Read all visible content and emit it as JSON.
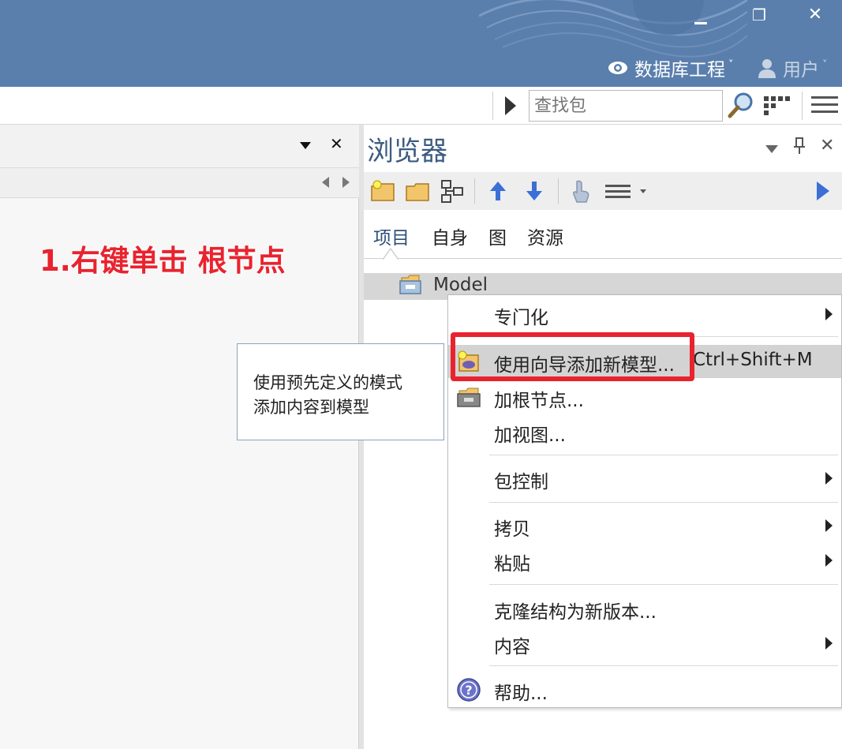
{
  "window": {
    "minimize_glyph": "▁",
    "restore_glyph": "❐",
    "close_glyph": "✕"
  },
  "header": {
    "project_label": "数据库工程",
    "user_label": "用户",
    "caret": "˅"
  },
  "toolbar": {
    "search_placeholder": "查找包"
  },
  "left_pane": {
    "close_glyph": "✕",
    "annotation": "1.右键单击 根节点"
  },
  "browser": {
    "title": "浏览器",
    "close_glyph": "✕",
    "tabs": [
      {
        "label": "项目",
        "active": true
      },
      {
        "label": "自身",
        "active": false
      },
      {
        "label": "图",
        "active": false
      },
      {
        "label": "资源",
        "active": false
      }
    ],
    "tree": {
      "root_label": "Model"
    }
  },
  "context_menu": {
    "items": [
      {
        "label": "专门化",
        "submenu": true
      },
      {
        "label": "使用向导添加新模型...",
        "shortcut": "Ctrl+Shift+M",
        "highlighted": true,
        "icon": "wizard-model-icon"
      },
      {
        "label": "加根节点...",
        "icon": "root-node-icon"
      },
      {
        "label": "加视图..."
      },
      {
        "label": "包控制",
        "submenu": true
      },
      {
        "label": "拷贝",
        "submenu": true
      },
      {
        "label": "粘贴",
        "submenu": true
      },
      {
        "label": "克隆结构为新版本..."
      },
      {
        "label": "内容",
        "submenu": true
      },
      {
        "label": "帮助...",
        "icon": "help-icon"
      }
    ]
  },
  "tooltip": {
    "line1": "使用预先定义的模式",
    "line2": "添加内容到模型"
  },
  "colors": {
    "titlebar": "#5a7fad",
    "annotation_red": "#e8232f",
    "browser_title": "#3c5c82",
    "arrow_blue": "#3b6fd6"
  }
}
